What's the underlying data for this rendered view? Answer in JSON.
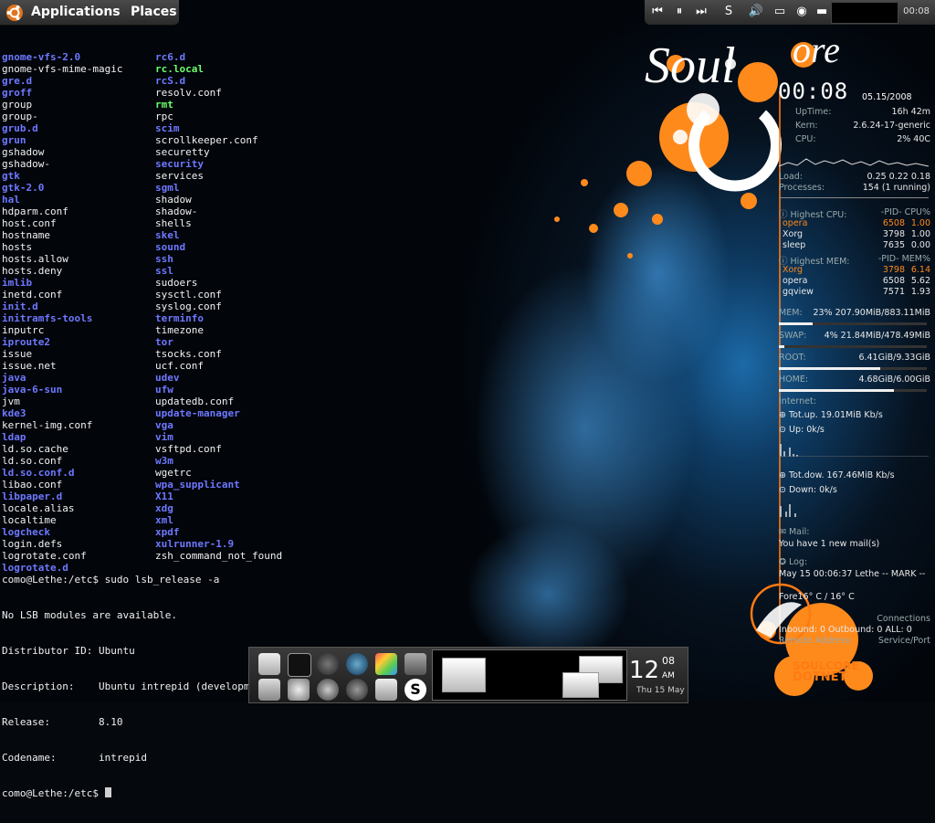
{
  "panel": {
    "menus": [
      "Applications",
      "Places"
    ],
    "tray_time": "00:08"
  },
  "terminal": {
    "col_a": [
      {
        "t": "gnome-vfs-2.0",
        "k": "dir"
      },
      {
        "t": "gnome-vfs-mime-magic",
        "k": "plain"
      },
      {
        "t": "gre.d",
        "k": "dir"
      },
      {
        "t": "groff",
        "k": "dir"
      },
      {
        "t": "group",
        "k": "plain"
      },
      {
        "t": "group-",
        "k": "plain"
      },
      {
        "t": "grub.d",
        "k": "dir"
      },
      {
        "t": "grun",
        "k": "dir"
      },
      {
        "t": "gshadow",
        "k": "plain"
      },
      {
        "t": "gshadow-",
        "k": "plain"
      },
      {
        "t": "gtk",
        "k": "dir"
      },
      {
        "t": "gtk-2.0",
        "k": "dir"
      },
      {
        "t": "hal",
        "k": "dir"
      },
      {
        "t": "hdparm.conf",
        "k": "plain"
      },
      {
        "t": "host.conf",
        "k": "plain"
      },
      {
        "t": "hostname",
        "k": "plain"
      },
      {
        "t": "hosts",
        "k": "plain"
      },
      {
        "t": "hosts.allow",
        "k": "plain"
      },
      {
        "t": "hosts.deny",
        "k": "plain"
      },
      {
        "t": "imlib",
        "k": "dir"
      },
      {
        "t": "inetd.conf",
        "k": "plain"
      },
      {
        "t": "init.d",
        "k": "dir"
      },
      {
        "t": "initramfs-tools",
        "k": "dir"
      },
      {
        "t": "inputrc",
        "k": "plain"
      },
      {
        "t": "iproute2",
        "k": "dir"
      },
      {
        "t": "issue",
        "k": "plain"
      },
      {
        "t": "issue.net",
        "k": "plain"
      },
      {
        "t": "java",
        "k": "dir"
      },
      {
        "t": "java-6-sun",
        "k": "dir"
      },
      {
        "t": "jvm",
        "k": "plain"
      },
      {
        "t": "kde3",
        "k": "dir"
      },
      {
        "t": "kernel-img.conf",
        "k": "plain"
      },
      {
        "t": "ldap",
        "k": "dir"
      },
      {
        "t": "ld.so.cache",
        "k": "plain"
      },
      {
        "t": "ld.so.conf",
        "k": "plain"
      },
      {
        "t": "ld.so.conf.d",
        "k": "dir"
      },
      {
        "t": "libao.conf",
        "k": "plain"
      },
      {
        "t": "libpaper.d",
        "k": "dir"
      },
      {
        "t": "locale.alias",
        "k": "plain"
      },
      {
        "t": "localtime",
        "k": "plain"
      },
      {
        "t": "logcheck",
        "k": "dir"
      },
      {
        "t": "login.defs",
        "k": "plain"
      },
      {
        "t": "logrotate.conf",
        "k": "plain"
      },
      {
        "t": "logrotate.d",
        "k": "dir"
      }
    ],
    "col_b": [
      {
        "t": "rc6.d",
        "k": "dir"
      },
      {
        "t": "rc.local",
        "k": "exe"
      },
      {
        "t": "rcS.d",
        "k": "dir"
      },
      {
        "t": "resolv.conf",
        "k": "plain"
      },
      {
        "t": "rmt",
        "k": "exe"
      },
      {
        "t": "rpc",
        "k": "plain"
      },
      {
        "t": "scim",
        "k": "dir"
      },
      {
        "t": "scrollkeeper.conf",
        "k": "plain"
      },
      {
        "t": "securetty",
        "k": "plain"
      },
      {
        "t": "security",
        "k": "dir"
      },
      {
        "t": "services",
        "k": "plain"
      },
      {
        "t": "sgml",
        "k": "dir"
      },
      {
        "t": "shadow",
        "k": "plain"
      },
      {
        "t": "shadow-",
        "k": "plain"
      },
      {
        "t": "shells",
        "k": "plain"
      },
      {
        "t": "skel",
        "k": "dir"
      },
      {
        "t": "sound",
        "k": "dir"
      },
      {
        "t": "ssh",
        "k": "dir"
      },
      {
        "t": "ssl",
        "k": "dir"
      },
      {
        "t": "sudoers",
        "k": "plain"
      },
      {
        "t": "sysctl.conf",
        "k": "plain"
      },
      {
        "t": "syslog.conf",
        "k": "plain"
      },
      {
        "t": "terminfo",
        "k": "dir"
      },
      {
        "t": "timezone",
        "k": "plain"
      },
      {
        "t": "tor",
        "k": "dir"
      },
      {
        "t": "tsocks.conf",
        "k": "plain"
      },
      {
        "t": "ucf.conf",
        "k": "plain"
      },
      {
        "t": "udev",
        "k": "dir"
      },
      {
        "t": "ufw",
        "k": "dir"
      },
      {
        "t": "updatedb.conf",
        "k": "plain"
      },
      {
        "t": "update-manager",
        "k": "dir"
      },
      {
        "t": "vga",
        "k": "dir"
      },
      {
        "t": "vim",
        "k": "dir"
      },
      {
        "t": "vsftpd.conf",
        "k": "plain"
      },
      {
        "t": "w3m",
        "k": "dir"
      },
      {
        "t": "wgetrc",
        "k": "plain"
      },
      {
        "t": "wpa_supplicant",
        "k": "dir"
      },
      {
        "t": "X11",
        "k": "dir"
      },
      {
        "t": "xdg",
        "k": "dir"
      },
      {
        "t": "xml",
        "k": "dir"
      },
      {
        "t": "xpdf",
        "k": "dir"
      },
      {
        "t": "xulrunner-1.9",
        "k": "dir"
      },
      {
        "t": "zsh_command_not_found",
        "k": "plain"
      }
    ],
    "after_lines": [
      "como@Lethe:/etc$ sudo lsb_release -a",
      "No LSB modules are available.",
      "Distributor ID: Ubuntu",
      "Description:    Ubuntu intrepid (development branch)",
      "Release:        8.10",
      "Codename:       intrepid"
    ],
    "prompt": "como@Lethe:/etc$ "
  },
  "conky": {
    "time": "00:08",
    "date": "05.15/2008",
    "uptime_label": "UpTime:",
    "uptime": "16h 42m",
    "kern_label": "Kern:",
    "kern": "2.6.24-17-generic",
    "cpu_label": "CPU:",
    "cpu": "2% 40C",
    "load_label": "Load:",
    "load": "0.25 0.22 0.18",
    "proc_label": "Processes:",
    "proc": "154  (1 running)",
    "hcpu_label": "Highest CPU:",
    "hcpu_cols": "-PID-  CPU%",
    "hcpu": [
      [
        "opera",
        "6508",
        "1.00"
      ],
      [
        "Xorg",
        "3798",
        "1.00"
      ],
      [
        "sleep",
        "7635",
        "0.00"
      ]
    ],
    "hmem_label": "Highest MEM:",
    "hmem_cols": "-PID-  MEM%",
    "hmem": [
      [
        "Xorg",
        "3798",
        "6.14"
      ],
      [
        "opera",
        "6508",
        "5.62"
      ],
      [
        "gqview",
        "7571",
        "1.93"
      ]
    ],
    "mem_label": "MEM:",
    "mem": "23% 207.90MiB/883.11MiB",
    "mem_frac": 0.23,
    "swap_label": "SWAP:",
    "swap": "4% 21.84MiB/478.49MiB",
    "swap_frac": 0.04,
    "root_label": "ROOT:",
    "root": "6.41GiB/9.33GiB",
    "root_frac": 0.687,
    "home_label": "HOME:",
    "home": "4.68GiB/6.00GiB",
    "home_frac": 0.78,
    "internet_label": "Internet:",
    "totup": "Tot.up. 19.01MiB Kb/s",
    "up": "Up: 0k/s",
    "totdown": "Tot.dow. 167.46MiB Kb/s",
    "down": "Down: 0k/s",
    "mail_label": "Mail:",
    "mail": "You have 1 new mail(s)",
    "log_label": "Log:",
    "log": "May 15 00:06:37 Lethe -- MARK --",
    "forecast": "Fore16° C / 16° C",
    "connections_label": "Connections",
    "conn": "Inbound: 0  Outbound: 0     ALL: 0",
    "remote": "Remote Address:",
    "service": "Service/Port"
  },
  "dock": {
    "clock_hour": "12",
    "clock_min": "08",
    "clock_ampm": "AM",
    "clock_date": "Thu 15 May"
  },
  "brand": {
    "line1": "SOULCORE",
    "line2": "DOTNET"
  },
  "colors": {
    "accent": "#ff7a12",
    "dir": "#6e78ff",
    "exe": "#6bff6b"
  }
}
